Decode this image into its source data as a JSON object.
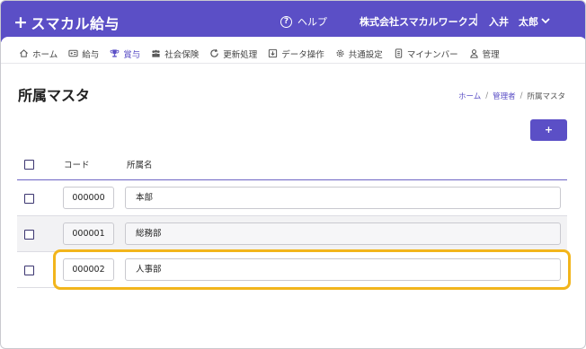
{
  "app": {
    "plus_glyph": "+",
    "logo_text": "スマカル給与",
    "help_icon_glyph": "?",
    "help_label": "ヘルプ",
    "company_name": "株式会社スマカルワークス",
    "separator": "|",
    "user_name": "入井　太郎"
  },
  "nav": [
    {
      "label": "ホーム",
      "icon": "home-icon"
    },
    {
      "label": "給与",
      "icon": "payslip-icon"
    },
    {
      "label": "賞与",
      "icon": "trophy-icon",
      "active": true
    },
    {
      "label": "社会保険",
      "icon": "people-icon"
    },
    {
      "label": "更新処理",
      "icon": "refresh-icon"
    },
    {
      "label": "データ操作",
      "icon": "data-icon"
    },
    {
      "label": "共通設定",
      "icon": "gear-icon"
    },
    {
      "label": "マイナンバー",
      "icon": "id-card-icon"
    },
    {
      "label": "管理",
      "icon": "person-icon"
    }
  ],
  "page": {
    "title": "所属マスタ",
    "breadcrumb": [
      "ホーム",
      "管理者",
      "所属マスタ"
    ],
    "breadcrumb_separator": "/",
    "add_button_label": "+"
  },
  "table": {
    "headers": {
      "code": "コード",
      "name": "所属名"
    },
    "rows": [
      {
        "code": "000000",
        "name": "本部"
      },
      {
        "code": "000001",
        "name": "総務部"
      },
      {
        "code": "000002",
        "name": "人事部"
      }
    ]
  },
  "colors": {
    "accent": "#5b4fc6",
    "highlight": "#f2b51c"
  }
}
